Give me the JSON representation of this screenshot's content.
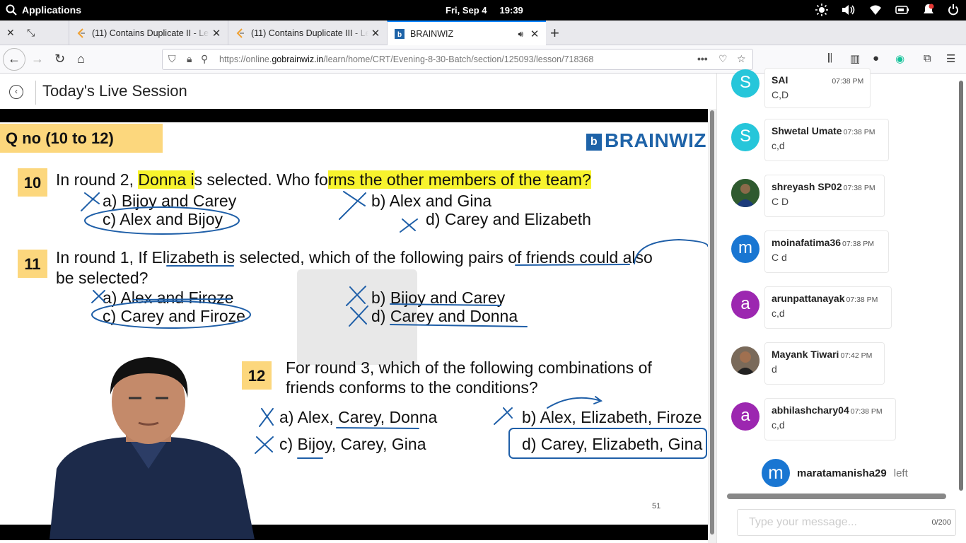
{
  "topbar": {
    "applications": "Applications",
    "date": "Fri, Sep  4",
    "time": "19:39"
  },
  "tabs": [
    {
      "title": "(11) Contains Duplicate II - Le"
    },
    {
      "title": "(11) Contains Duplicate III - Le"
    },
    {
      "title": "BRAINWIZ"
    }
  ],
  "address": {
    "url_prefix": "https://online.",
    "url_domain": "gobrainwiz.in",
    "url_path": "/learn/home/CRT/Evening-8-30-Batch/section/125093/lesson/718368"
  },
  "page": {
    "title": "Today's Live Session"
  },
  "slide": {
    "header": "Q no (10 to 12)",
    "brand": "BRAINWIZ",
    "page_number": "51",
    "q10": {
      "num": "10",
      "text_a": "In round 2, ",
      "text_hl1": "Donna i",
      "text_b": "s selected. Who fo",
      "text_hl2": "rms the other members of the team?",
      "opt_a": "a) Bijoy and Carey",
      "opt_b": "b) Alex and Gina",
      "opt_c": "c) Alex and Bijoy",
      "opt_d": "d) Carey and Elizabeth"
    },
    "q11": {
      "num": "11",
      "line1": "In round 1, If Elizabeth is selected, which of the following pairs of friends could also",
      "line2": "be selected?",
      "opt_a": "a) Alex and Firoze",
      "opt_b": "b) Bijoy and Carey",
      "opt_c": "c) Carey and Firoze",
      "opt_d": "d) Carey and Donna"
    },
    "q12": {
      "num": "12",
      "line1": "For round 3, which of the following combinations of",
      "line2": "friends conforms to the conditions?",
      "opt_a": "a) Alex, Carey, Donna",
      "opt_b": "b) Alex, Elizabeth, Firoze",
      "opt_c": "c) Bijoy, Carey, Gina",
      "opt_d": "d) Carey, Elizabeth, Gina"
    }
  },
  "chat": {
    "messages": [
      {
        "initial": "S",
        "color": "#26c6da",
        "name": "SAI",
        "time": "07:38 PM",
        "text": "C,D"
      },
      {
        "initial": "S",
        "color": "#26c6da",
        "name": "Shwetal Umate",
        "time": "07:38 PM",
        "text": "c,d"
      },
      {
        "initial": "",
        "color": "#3a6b3a",
        "name": "shreyash SP02",
        "time": "07:38 PM",
        "text": "C D"
      },
      {
        "initial": "m",
        "color": "#1976d2",
        "name": "moinafatima36",
        "time": "07:38 PM",
        "text": "C d"
      },
      {
        "initial": "a",
        "color": "#9c27b0",
        "name": "arunpattanayak",
        "time": "07:38 PM",
        "text": "c,d"
      },
      {
        "initial": "",
        "color": "#5d4a3a",
        "name": "Mayank Tiwari",
        "time": "07:42 PM",
        "text": "d"
      },
      {
        "initial": "a",
        "color": "#9c27b0",
        "name": "abhilashchary04",
        "time": "07:38 PM",
        "text": "c,d"
      }
    ],
    "left_event": {
      "initial": "m",
      "name": "maratamanisha29",
      "status": "left"
    },
    "input_placeholder": "Type your message...",
    "char_count": "0/200"
  }
}
